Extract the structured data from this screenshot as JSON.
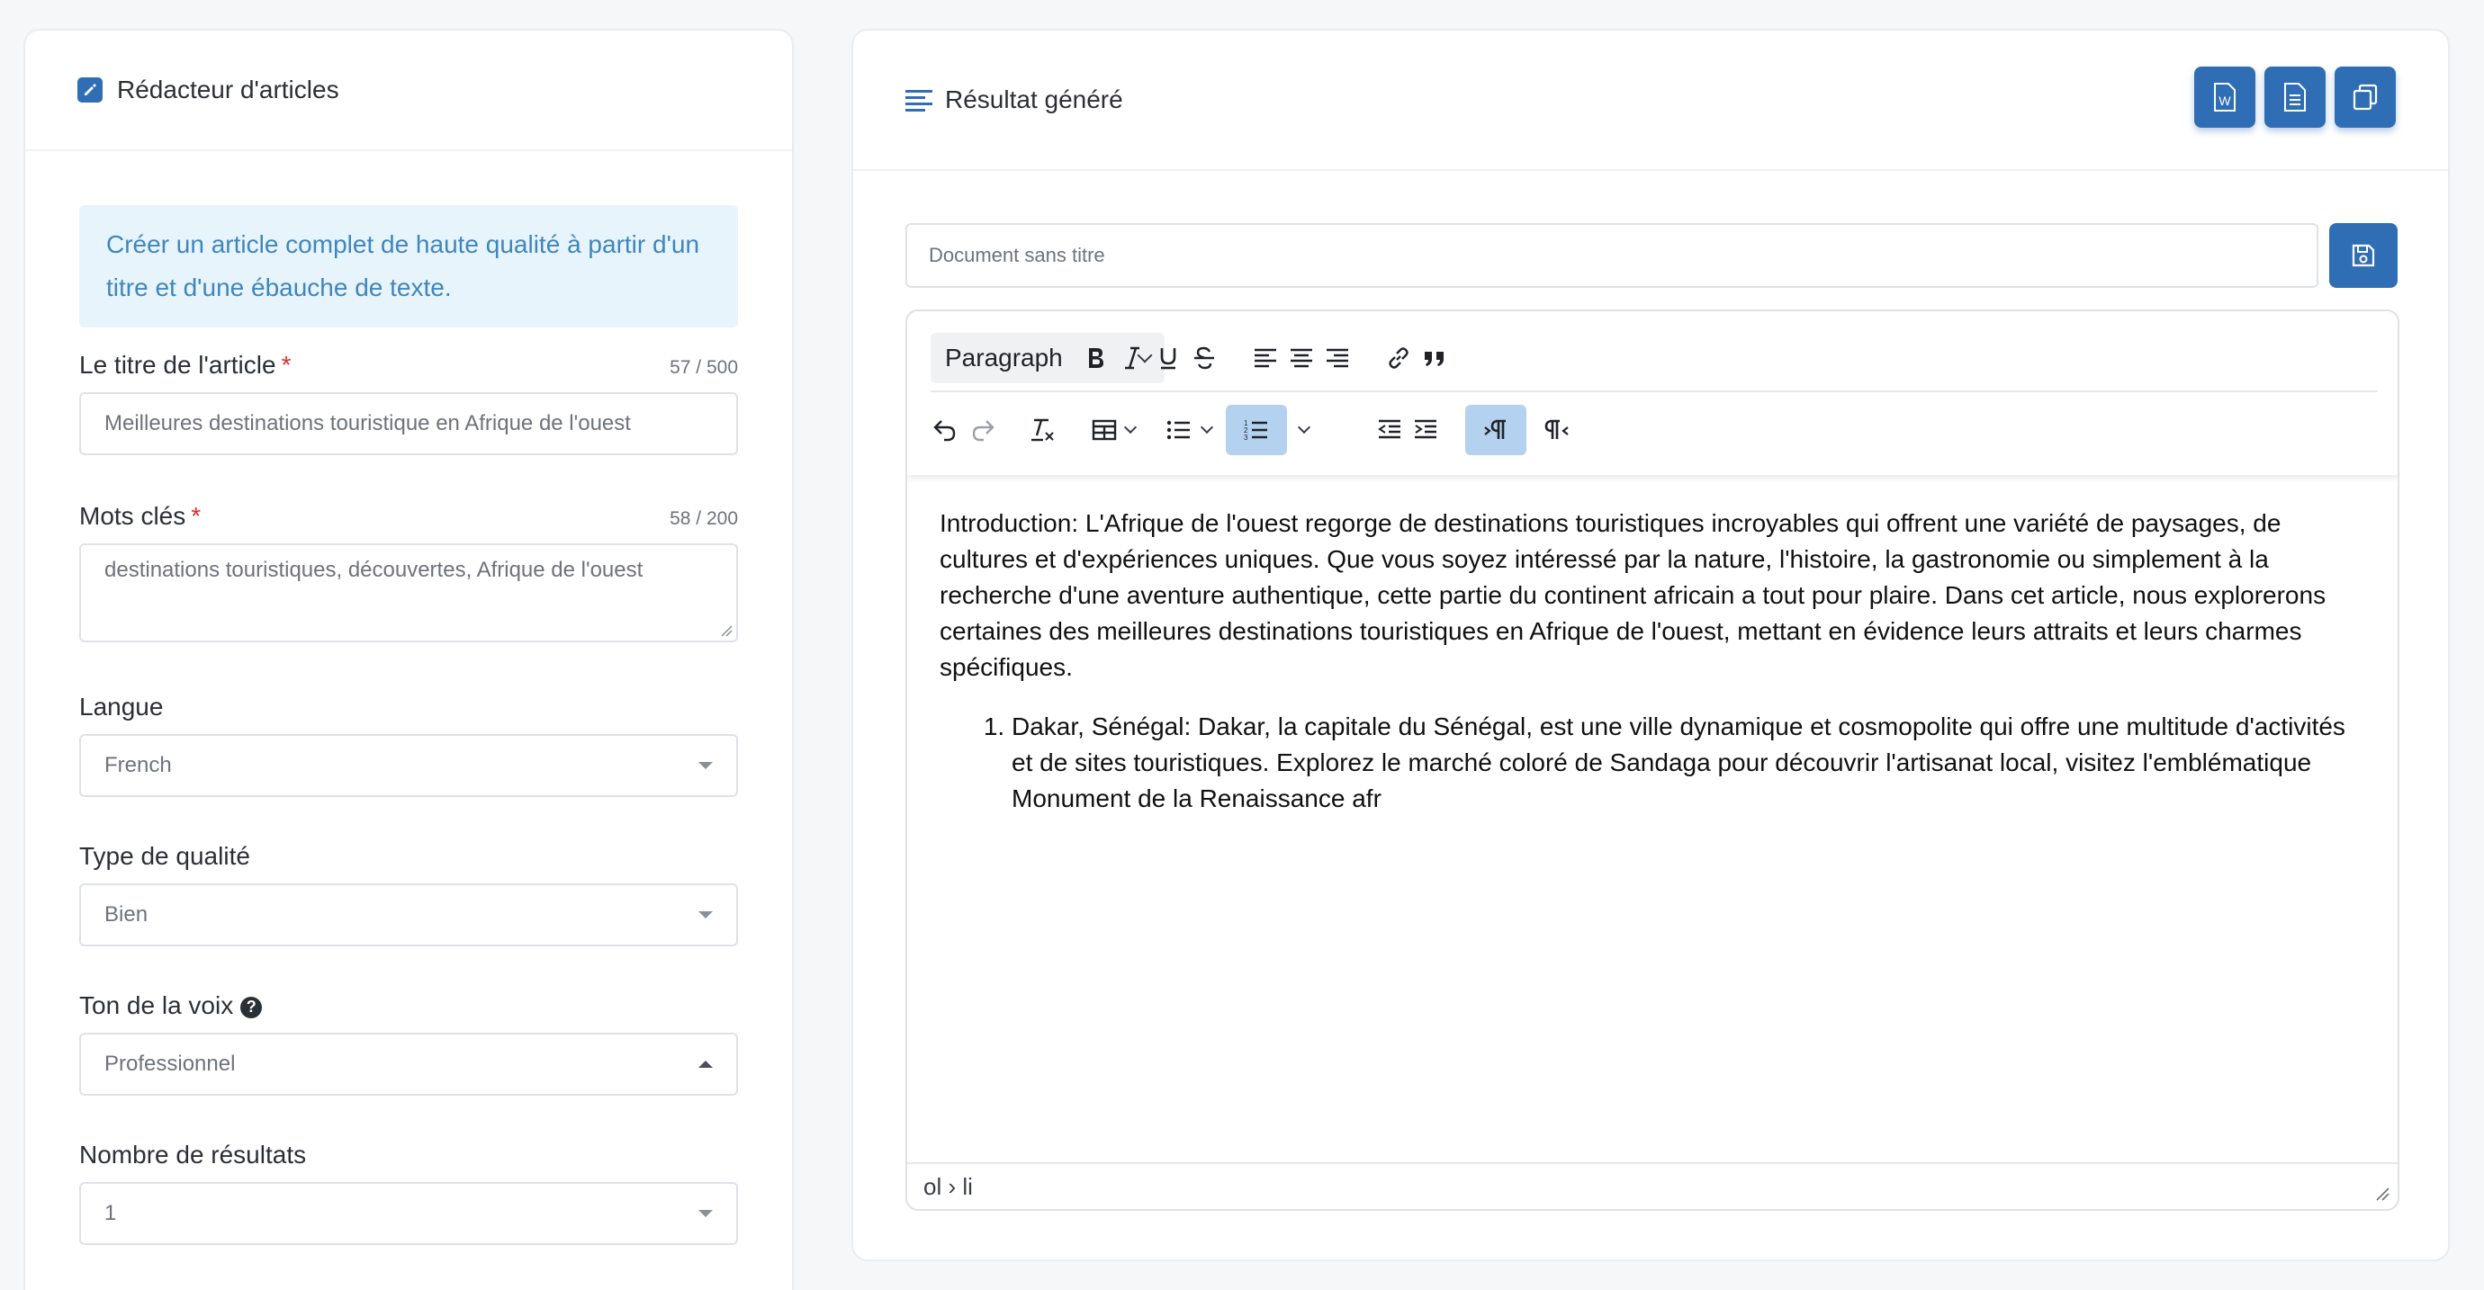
{
  "colors": {
    "accent": "#2f6eb5",
    "info_bg": "#e8f4fb",
    "info_text": "#3f86bd",
    "required": "#e02b2b",
    "active_btn": "#b5d1f0"
  },
  "left_panel": {
    "title": "Rédacteur d'articles",
    "title_icon": "edit-icon",
    "info": "Créer un article complet de haute qualité à partir d'un titre et d'une ébauche de texte.",
    "fields": {
      "title": {
        "label": "Le titre de l'article",
        "required": "*",
        "counter": "57 / 500",
        "value": "Meilleures destinations touristique en Afrique de l'ouest"
      },
      "keywords": {
        "label": "Mots clés",
        "required": "*",
        "counter": "58 / 200",
        "value": "destinations touristiques, découvertes, Afrique de l'ouest"
      },
      "language": {
        "label": "Langue",
        "value": "French"
      },
      "quality": {
        "label": "Type de qualité",
        "value": "Bien"
      },
      "tone": {
        "label": "Ton de la voix",
        "help": "?",
        "value": "Professionnel"
      },
      "results": {
        "label": "Nombre de résultats",
        "value": "1"
      }
    }
  },
  "right_panel": {
    "title": "Résultat généré",
    "title_icon": "align-left-icon",
    "header_buttons": [
      "word-doc-icon",
      "text-doc-icon",
      "copy-icon"
    ],
    "doc_title_placeholder": "Document sans titre",
    "editor": {
      "format_select": "Paragraph",
      "toolbar_row1": [
        "bold-icon",
        "italic-icon",
        "underline-icon",
        "strikethrough-icon",
        "align-left-icon",
        "align-center-icon",
        "align-right-icon",
        "link-icon",
        "blockquote-icon"
      ],
      "toolbar_row2": [
        "undo-icon",
        "redo-icon",
        "clear-format-icon",
        "table-icon",
        "bullet-list-icon",
        "numbered-list-icon",
        "outdent-icon",
        "indent-icon",
        "ltr-icon",
        "rtl-icon"
      ],
      "intro": "Introduction: L'Afrique de l'ouest regorge de destinations touristiques incroyables qui offrent une variété de paysages, de cultures et d'expériences uniques. Que vous soyez intéressé par la nature, l'histoire, la gastronomie ou simplement à la recherche d'une aventure authentique, cette partie du continent africain a tout pour plaire. Dans cet article, nous explorerons certaines des meilleures destinations touristiques en Afrique de l'ouest, mettant en évidence leurs attraits et leurs charmes spécifiques.",
      "list_items": [
        "Dakar, Sénégal: Dakar, la capitale du Sénégal, est une ville dynamique et cosmopolite qui offre une multitude d'activités et de sites touristiques. Explorez le marché coloré de Sandaga pour découvrir l'artisanat local, visitez l'emblématique Monument de la Renaissance afr"
      ],
      "status_path": "ol › li"
    }
  }
}
